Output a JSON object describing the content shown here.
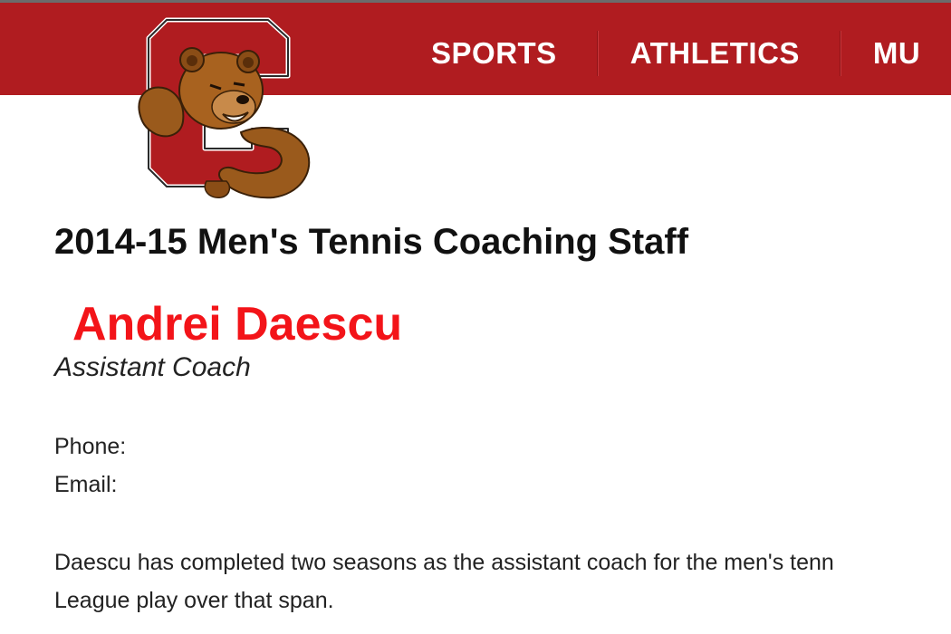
{
  "header": {
    "nav_items": [
      "SPORTS",
      "ATHLETICS",
      "MU"
    ],
    "accent_color": "#b01c20",
    "logo_icon": "bear-gripping-c-logo-icon"
  },
  "main": {
    "page_title": "2014-15 Men's Tennis Coaching Staff",
    "coach_name": "Andrei Daescu",
    "coach_name_color": "#f31419",
    "coach_role": "Assistant Coach",
    "phone_label": "Phone:",
    "email_label": "Email:",
    "bio_lines": [
      "Daescu has completed two seasons as the assistant coach for the men's tenn",
      "League play over that span."
    ]
  }
}
